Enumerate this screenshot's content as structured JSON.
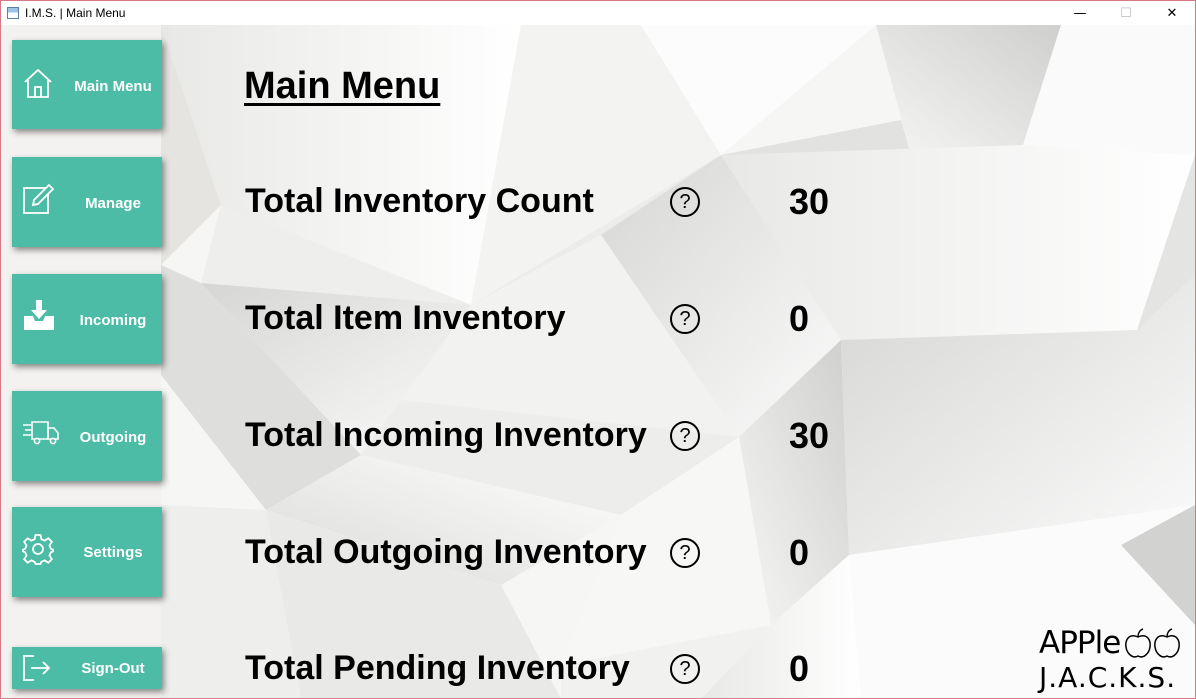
{
  "window": {
    "title": "I.M.S. | Main Menu",
    "controls": {
      "minimize": "—",
      "maximize": "☐",
      "close": "✕"
    }
  },
  "sidebar": {
    "items": [
      {
        "label": "Main Menu",
        "icon": "home-icon"
      },
      {
        "label": "Manage",
        "icon": "edit-icon"
      },
      {
        "label": "Incoming",
        "icon": "inbox-download-icon"
      },
      {
        "label": "Outgoing",
        "icon": "delivery-truck-icon"
      },
      {
        "label": "Settings",
        "icon": "gear-icon"
      },
      {
        "label": "Sign-Out",
        "icon": "sign-out-icon"
      }
    ]
  },
  "main": {
    "title": "Main Menu",
    "stats": [
      {
        "label": "Total Inventory Count",
        "help": "?",
        "value": "30"
      },
      {
        "label": "Total Item Inventory",
        "help": "?",
        "value": "0"
      },
      {
        "label": "Total Incoming Inventory",
        "help": "?",
        "value": "30"
      },
      {
        "label": "Total Outgoing Inventory",
        "help": "?",
        "value": "0"
      },
      {
        "label": "Total Pending Inventory",
        "help": "?",
        "value": "0"
      }
    ]
  },
  "brand": {
    "line1": "APPle",
    "line2": "J.A.C.K.S."
  },
  "colors": {
    "accent": "#4dbca7",
    "text": "#000000",
    "window_border": "#d77a86"
  }
}
